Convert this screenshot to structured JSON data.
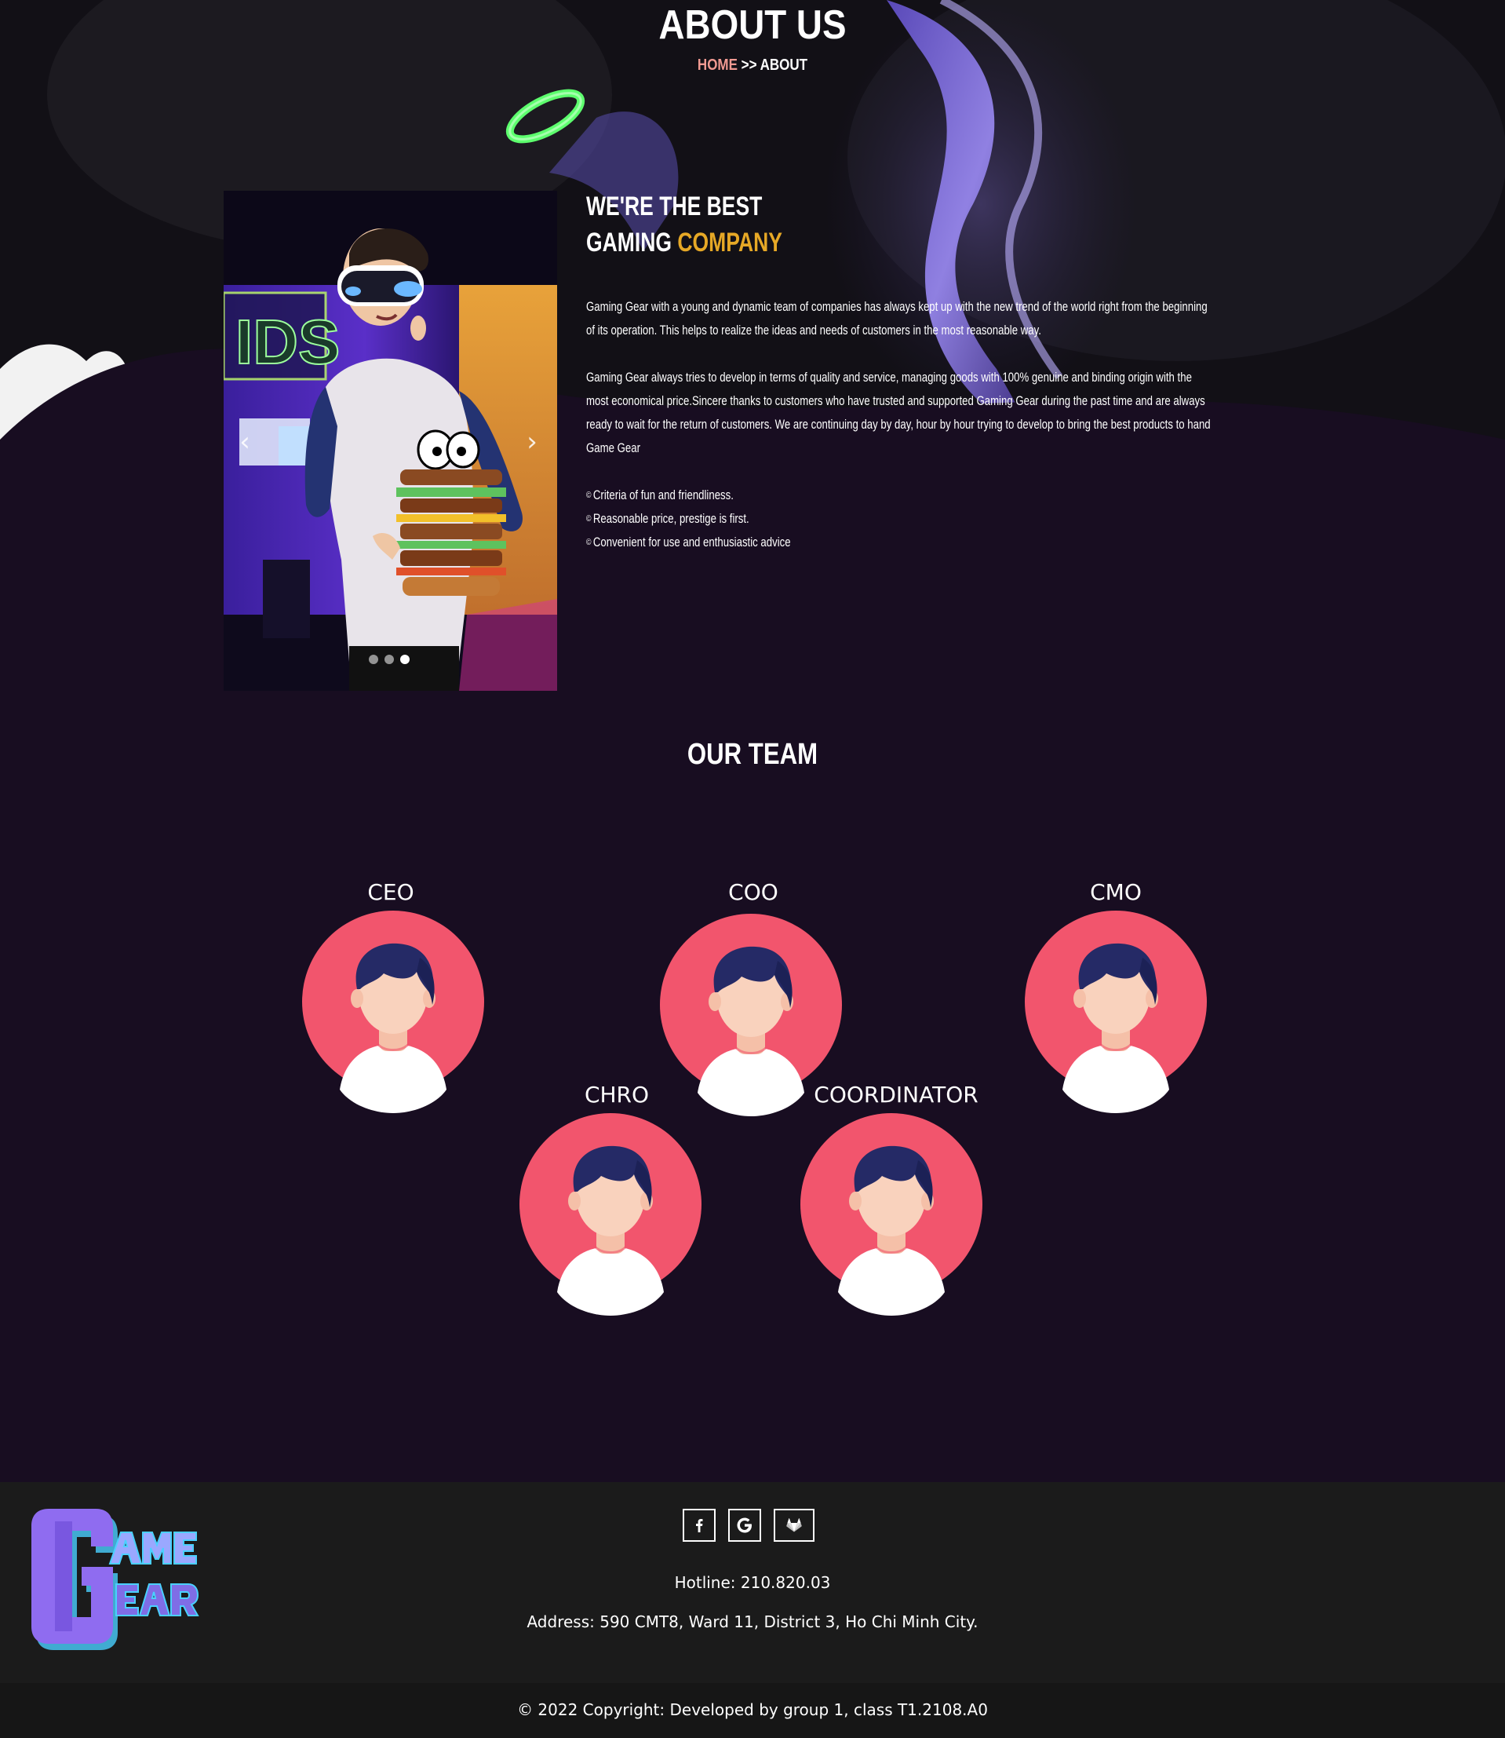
{
  "header": {
    "title": "ABOUT US",
    "breadcrumb": {
      "home": "HOME",
      "separator": ">>",
      "current": "ABOUT"
    }
  },
  "about": {
    "heading_line1": "WE'RE THE BEST",
    "heading_line2_prefix": "GAMING ",
    "heading_line2_highlight": "COMPANY",
    "paragraph1": "Gaming Gear with a young and dynamic team of companies has always kept up with the new trend of the world right from the beginning of its operation. This helps to realize the ideas and needs of customers in the most reasonable way.",
    "paragraph2": "Gaming Gear always tries to develop in terms of quality and service, managing goods with 100% genuine and binding origin with the most economical price.Sincere thanks to customers who have trusted and supported Gaming Gear during the past time and are always ready to wait for the return of customers. We are continuing day by day, hour by hour trying to develop to bring the best products to hand Game Gear",
    "bullet_symbol": "©",
    "bullets": [
      "Criteria of fun and friendliness.",
      "Reasonable price, prestige is first.",
      "Convenient for use and enthusiastic advice"
    ],
    "slider": {
      "slide_count": 3,
      "active_slide": 3,
      "prev_icon": "chevron-left-icon",
      "next_icon": "chevron-right-icon"
    }
  },
  "team": {
    "title": "OUR TEAM",
    "members": [
      {
        "role": "CEO"
      },
      {
        "role": "COO"
      },
      {
        "role": "CMO"
      },
      {
        "role": "CHRO"
      },
      {
        "role": "COORDINATOR"
      }
    ]
  },
  "footer": {
    "logo_text": "GAME GEAR",
    "socials": [
      {
        "icon": "facebook-icon"
      },
      {
        "icon": "google-icon"
      },
      {
        "icon": "gitlab-icon"
      }
    ],
    "hotline": "Hotline: 210.820.03",
    "address": "Address: 590 CMT8, Ward 11, District 3, Ho Chi Minh City.",
    "copyright": "© 2022 Copyright: Developed by group 1, class T1.2108.A0"
  },
  "colors": {
    "accent_gold": "#e6a826",
    "breadcrumb_home": "#f19a92",
    "page_bg": "#180d21",
    "footer_bg": "#1b1b1b",
    "avatar_circle": "#f2556d"
  }
}
